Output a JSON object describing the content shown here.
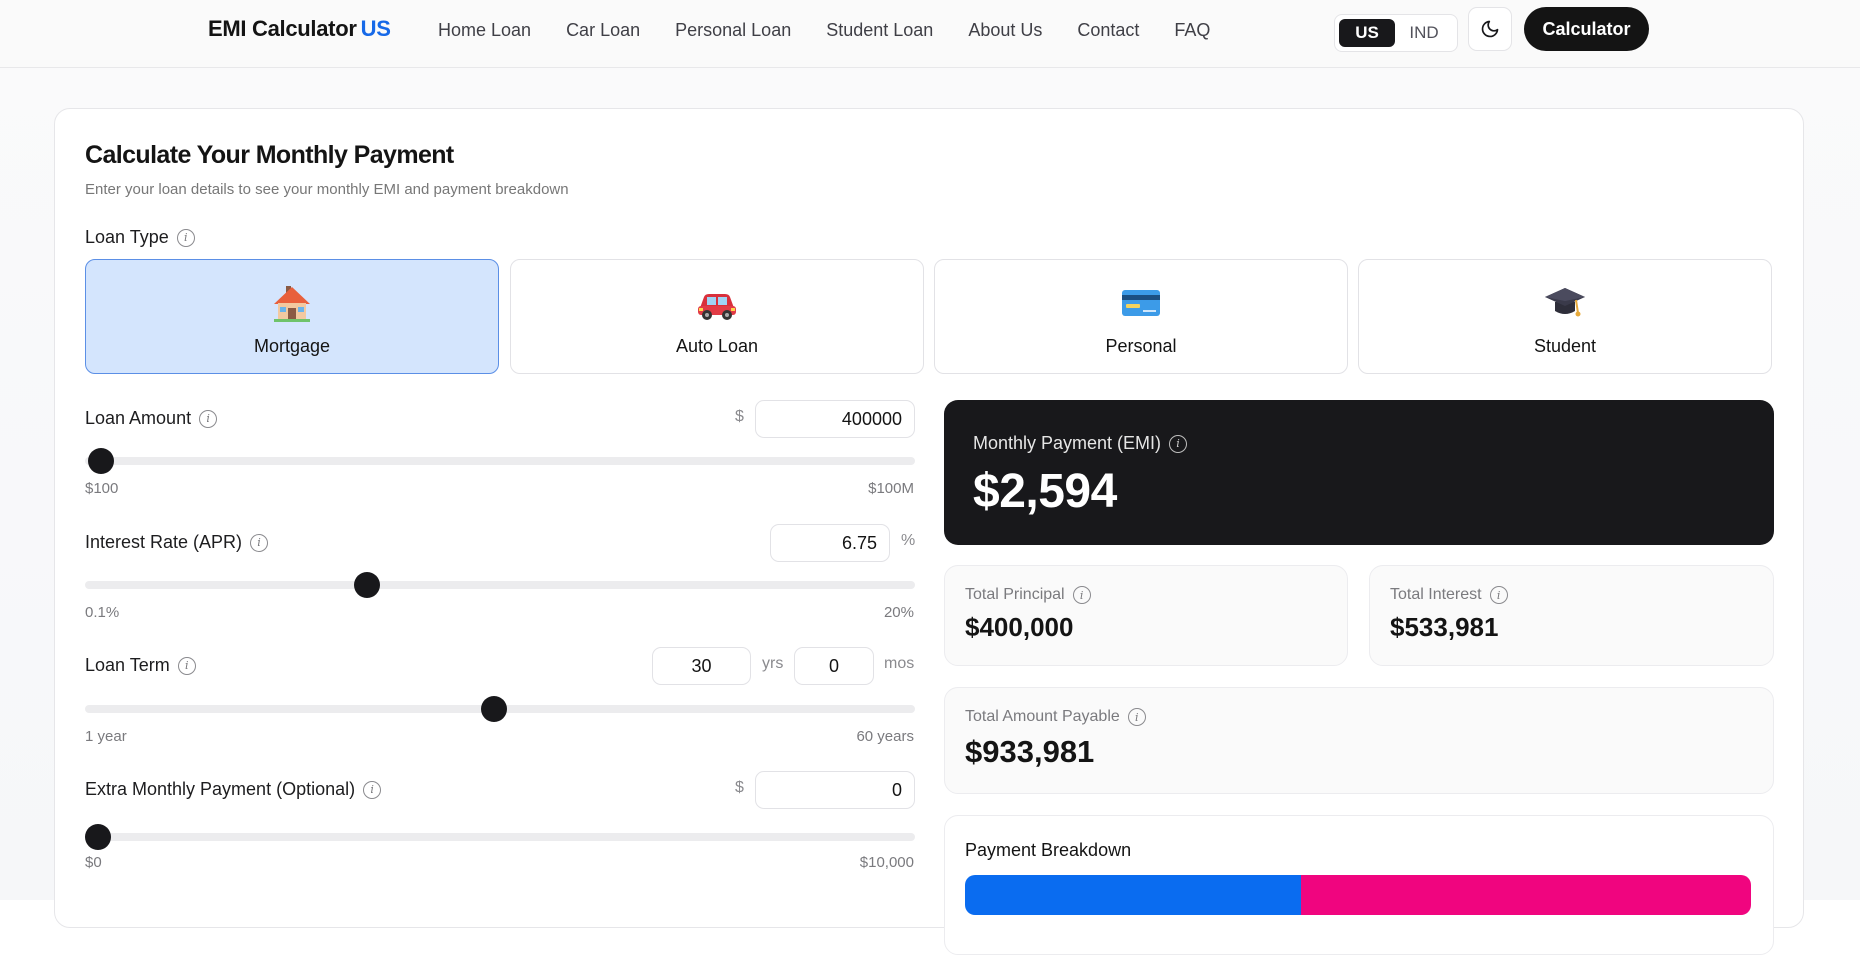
{
  "navbar": {
    "brand": "EMI Calculator",
    "brand_accent": "US",
    "links": [
      "Home Loan",
      "Car Loan",
      "Personal Loan",
      "Student Loan",
      "About Us",
      "Contact",
      "FAQ"
    ],
    "region_active": "US",
    "region_inactive": "IND",
    "theme_icon": "moon-icon",
    "cta": "Calculator"
  },
  "header": {
    "title": "Calculate Your Monthly Payment",
    "subtitle": "Enter your loan details to see your monthly EMI and payment breakdown"
  },
  "loan_type": {
    "label": "Loan Type",
    "options": [
      {
        "label": "Mortgage",
        "icon": "house-icon",
        "selected": true
      },
      {
        "label": "Auto Loan",
        "icon": "car-icon",
        "selected": false
      },
      {
        "label": "Personal",
        "icon": "credit-card-icon",
        "selected": false
      },
      {
        "label": "Student",
        "icon": "graduation-cap-icon",
        "selected": false
      }
    ]
  },
  "loan_amount": {
    "label": "Loan Amount",
    "currency": "$",
    "value": "400000",
    "min_label": "$100",
    "max_label": "$100M",
    "slider_fraction": 0.004
  },
  "interest_rate": {
    "label": "Interest Rate (APR)",
    "value": "6.75",
    "unit": "%",
    "min_label": "0.1%",
    "max_label": "20%",
    "slider_fraction": 0.334
  },
  "loan_term": {
    "label": "Loan Term",
    "years": "30",
    "years_unit": "yrs",
    "months": "0",
    "months_unit": "mos",
    "min_label": "1 year",
    "max_label": "60 years",
    "slider_fraction": 0.492
  },
  "extra_payment": {
    "label": "Extra Monthly Payment (Optional)",
    "currency": "$",
    "value": "0",
    "min_label": "$0",
    "max_label": "$10,000",
    "slider_fraction": 0.0
  },
  "results": {
    "emi_label": "Monthly Payment (EMI)",
    "emi_value": "$2,594",
    "total_principal_label": "Total Principal",
    "total_principal_value": "$400,000",
    "total_interest_label": "Total Interest",
    "total_interest_value": "$533,981",
    "total_payable_label": "Total Amount Payable",
    "total_payable_value": "$933,981"
  },
  "breakdown": {
    "title": "Payment Breakdown",
    "principal_fraction": 0.428,
    "interest_fraction": 0.572,
    "principal_color": "#0a6cf0",
    "interest_color": "#f0057f"
  },
  "colors": {
    "accent": "#1669e8",
    "dark": "#18181b",
    "selected_bg": "#d4e5fd"
  }
}
